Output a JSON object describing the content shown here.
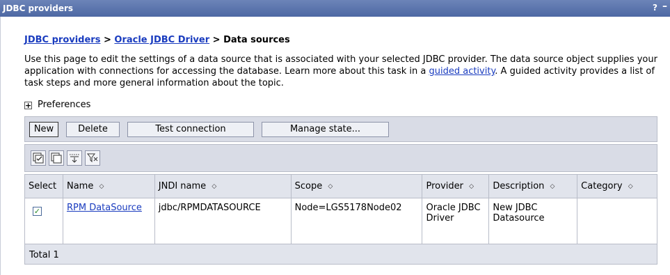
{
  "window": {
    "title": "JDBC providers",
    "help": "?",
    "minimize": "–"
  },
  "breadcrumb": {
    "link1": "JDBC providers",
    "sep1": " > ",
    "link2": "Oracle JDBC Driver",
    "sep2": " > ",
    "current": "Data sources"
  },
  "description": {
    "text1": "Use this page to edit the settings of a data source that is associated with your selected JDBC provider. The data source object supplies your application with connections for accessing the database. Learn more about this task in a ",
    "link": "guided activity",
    "text2": ". A guided activity provides a list of task steps and more general information about the topic."
  },
  "preferences": {
    "toggle": "+",
    "label": "Preferences"
  },
  "toolbar": {
    "new_label": "New",
    "delete_label": "Delete",
    "test_label": "Test connection",
    "manage_label": "Manage state..."
  },
  "icon_toolbar": [
    "select-all-icon",
    "deselect-all-icon",
    "show-filter-icon",
    "clear-filter-icon"
  ],
  "table": {
    "headers": [
      "Select",
      "Name",
      "JNDI name",
      "Scope",
      "Provider",
      "Description",
      "Category"
    ],
    "sort_glyph": "◇",
    "rows": [
      {
        "selected": true,
        "name": "RPM DataSource",
        "jndi": "jdbc/RPMDATASOURCE",
        "scope": "Node=LGS5178Node02",
        "provider": "Oracle JDBC Driver",
        "description": "New JDBC Datasource",
        "category": ""
      }
    ],
    "total": "Total 1"
  },
  "colors": {
    "titlebar": "#4d68a3",
    "link": "#1a3cbf",
    "toolbar": "#d9dce6",
    "header": "#e1e4ec"
  }
}
